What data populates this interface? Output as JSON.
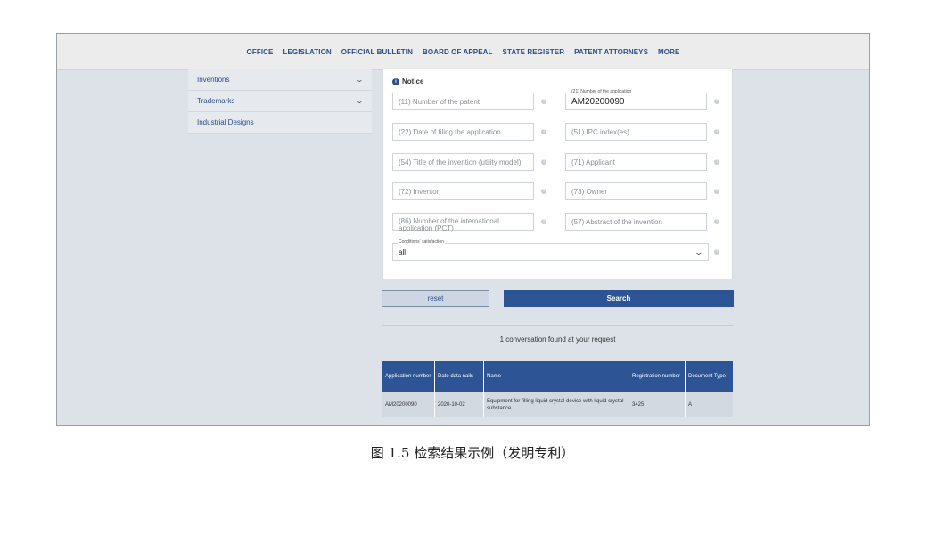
{
  "nav": {
    "items": [
      "OFFICE",
      "LEGISLATION",
      "OFFICIAL BULLETIN",
      "BOARD OF APPEAL",
      "STATE REGISTER",
      "PATENT ATTORNEYS",
      "MORE"
    ]
  },
  "sidebar": {
    "items": [
      {
        "label": "Inventions",
        "icon": "chevron-down-icon"
      },
      {
        "label": "Trademarks",
        "icon": "chevron-down-icon"
      },
      {
        "label": "Industrial Designs"
      }
    ]
  },
  "form": {
    "notice": "Notice",
    "fields": {
      "patent_number": {
        "placeholder": "(11) Number of the patent"
      },
      "application_number": {
        "label": "(21) Number of the application",
        "value": "AM20200090"
      },
      "filing_date": {
        "placeholder": "(22) Date of filing the application"
      },
      "ipc_index": {
        "placeholder": "(51) IPC index(es)"
      },
      "title": {
        "placeholder": "(54) Title of the invention (utility model)"
      },
      "applicant": {
        "placeholder": "(71) Applicant"
      },
      "inventor": {
        "placeholder": "(72) Inventor"
      },
      "owner": {
        "placeholder": "(73) Owner"
      },
      "intl_application": {
        "placeholder": "(86) Number of the international application (PCT)"
      },
      "abstract": {
        "placeholder": "(57) Abstract of the invention"
      }
    },
    "conditions": {
      "label": "Conditions' satisfaction",
      "value": "all"
    }
  },
  "buttons": {
    "reset": "reset",
    "search": "Search"
  },
  "results": {
    "count_text": "1 conversation found at your request",
    "columns": [
      "Application number",
      "Date data nails",
      "Name",
      "Registration number",
      "Document Type"
    ],
    "rows": [
      [
        "AM20200090",
        "2020-10-02",
        "Equipment for filling liquid crystal device with liquid crystal substance",
        "3425",
        "A"
      ]
    ]
  },
  "caption": "图 1.5  检索结果示例（发明专利）"
}
